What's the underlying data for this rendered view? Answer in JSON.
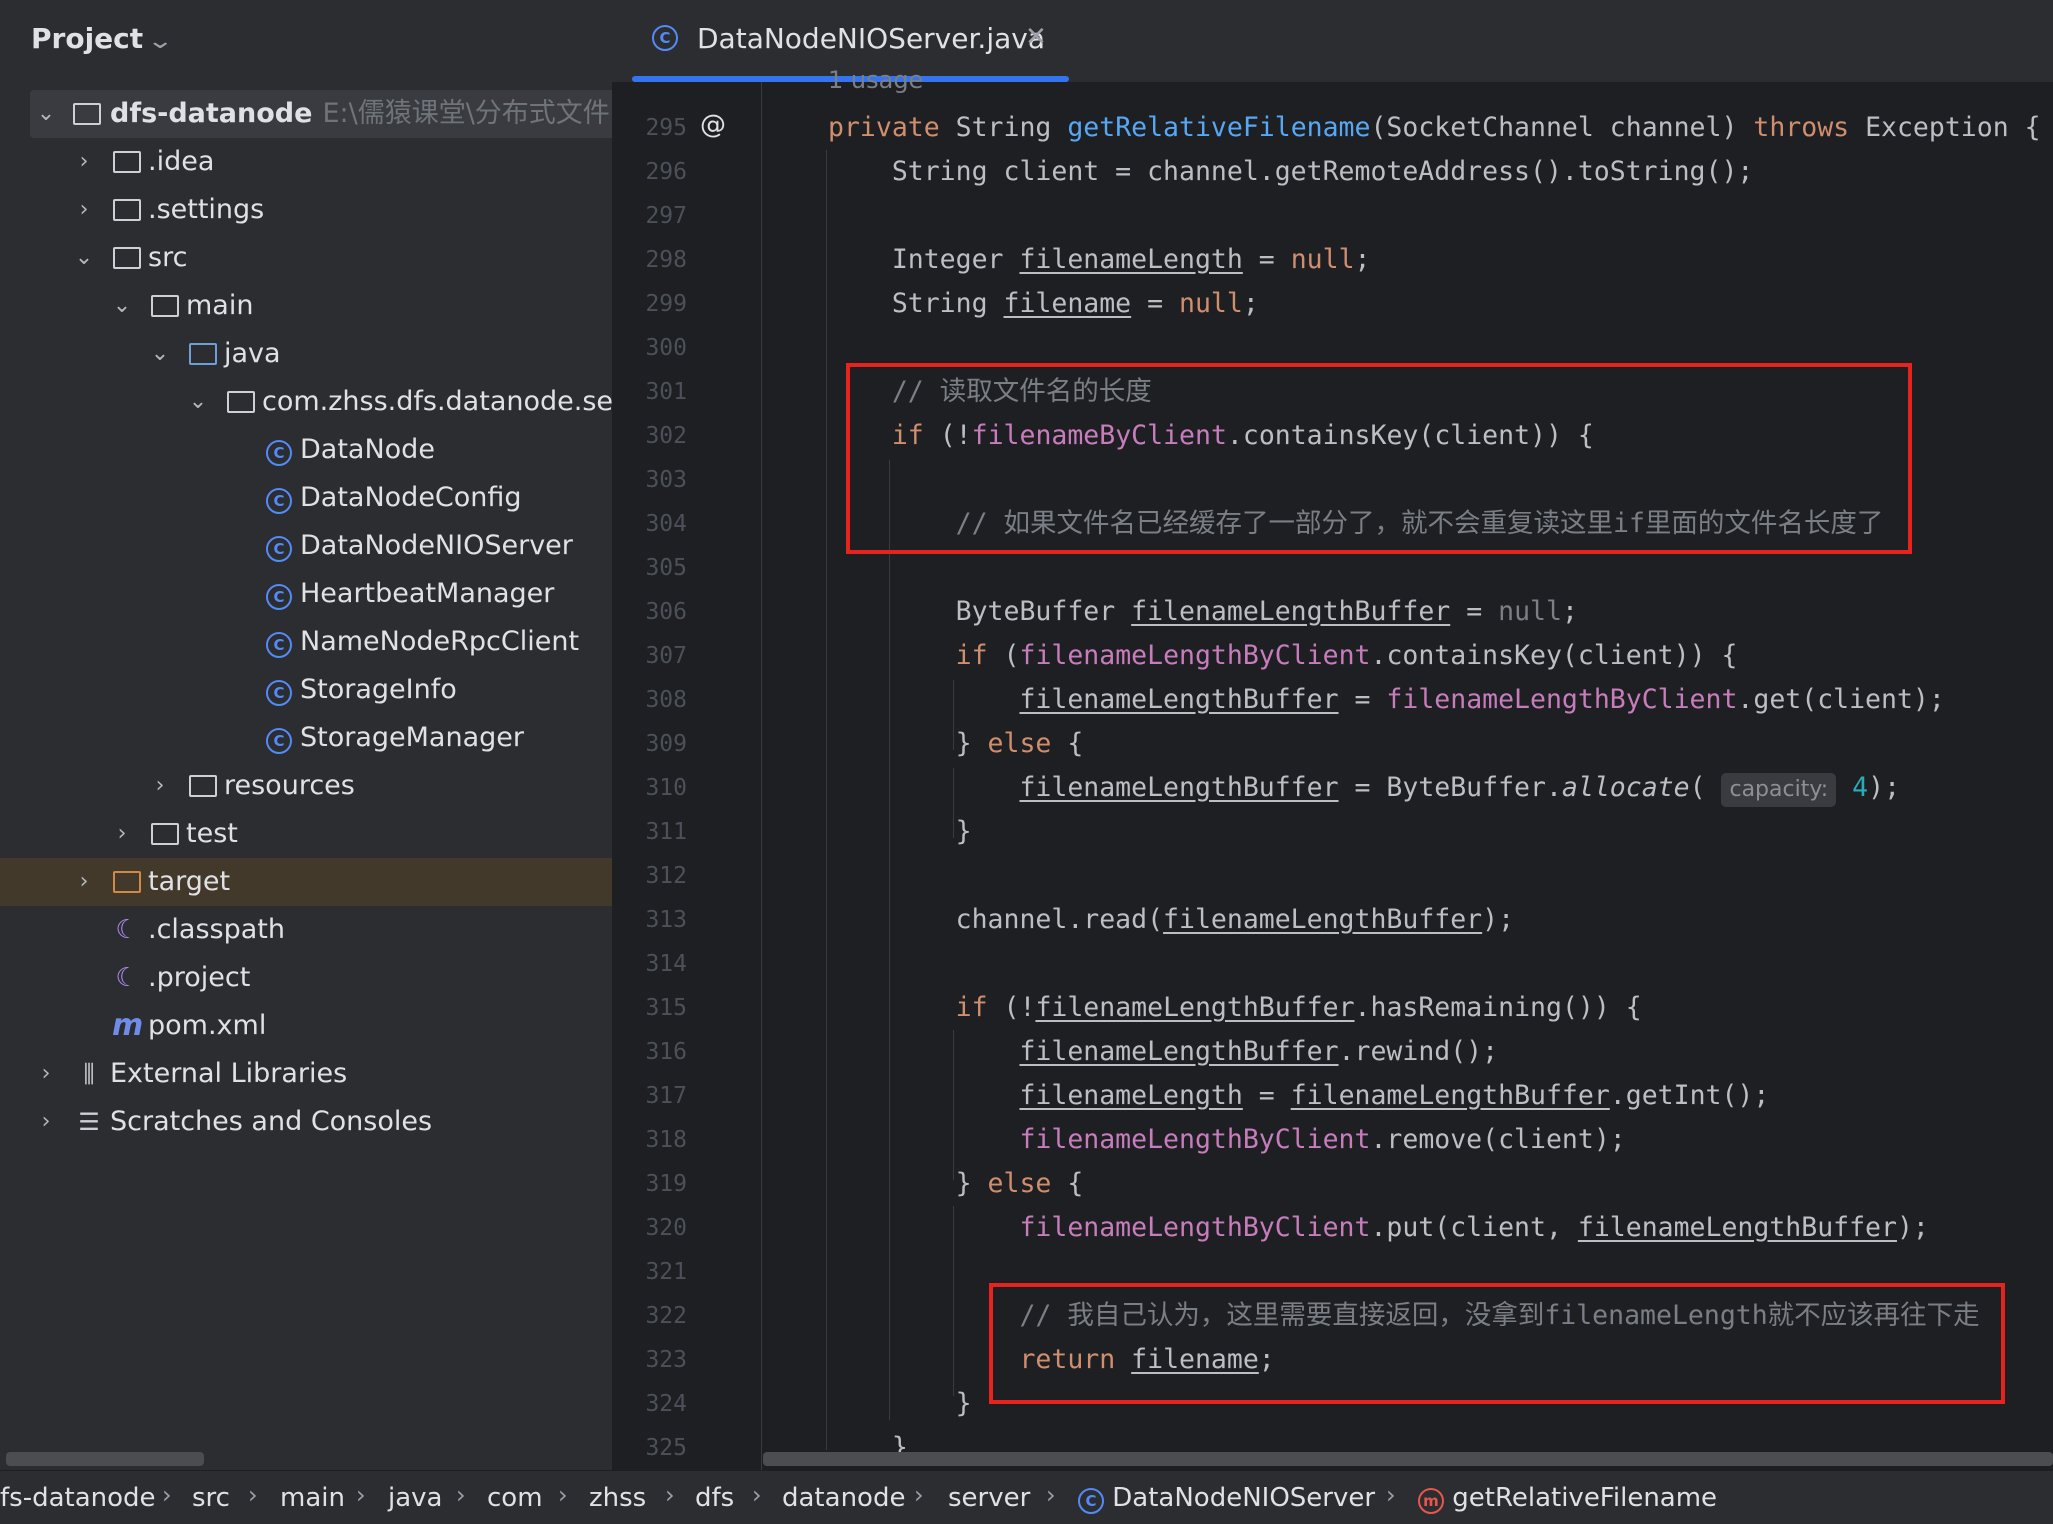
{
  "sidebar": {
    "title": "Project",
    "root": {
      "name": "dfs-datanode",
      "path_hint": "E:\\儒猿课堂\\分布式文件系统"
    },
    "items": [
      {
        "label": ".idea"
      },
      {
        "label": ".settings"
      },
      {
        "label": "src"
      },
      {
        "label": "main"
      },
      {
        "label": "java"
      },
      {
        "label": "com.zhss.dfs.datanode.server"
      },
      {
        "label": "DataNode"
      },
      {
        "label": "DataNodeConfig"
      },
      {
        "label": "DataNodeNIOServer"
      },
      {
        "label": "HeartbeatManager"
      },
      {
        "label": "NameNodeRpcClient"
      },
      {
        "label": "StorageInfo"
      },
      {
        "label": "StorageManager"
      },
      {
        "label": "resources"
      },
      {
        "label": "test"
      },
      {
        "label": "target"
      },
      {
        "label": ".classpath"
      },
      {
        "label": ".project"
      },
      {
        "label": "pom.xml"
      },
      {
        "label": "External Libraries"
      },
      {
        "label": "Scratches and Consoles"
      }
    ]
  },
  "editor": {
    "tab": {
      "label": "DataNodeNIOServer.java"
    },
    "usage_hint": "1 usage",
    "param_hint": "capacity:",
    "line_numbers": [
      "295",
      "296",
      "297",
      "298",
      "299",
      "300",
      "301",
      "302",
      "303",
      "304",
      "305",
      "306",
      "307",
      "308",
      "309",
      "310",
      "311",
      "312",
      "313",
      "314",
      "315",
      "316",
      "317",
      "318",
      "319",
      "320",
      "321",
      "322",
      "323",
      "324",
      "325"
    ],
    "comment_301": "// 读取文件名的长度",
    "comment_304": "// 如果文件名已经缓存了一部分了，就不会重复读这里if里面的文件名长度了",
    "comment_322": "// 我自己认为，这里需要直接返回，没拿到filenameLength就不应该再往下走"
  },
  "breadcrumb": [
    "fs-datanode",
    "src",
    "main",
    "java",
    "com",
    "zhss",
    "dfs",
    "datanode",
    "server",
    "DataNodeNIOServer",
    "getRelativeFilename"
  ],
  "colors": {
    "highlight_box": "#e8231d",
    "tab_accent": "#3574f0",
    "keyword": "#cf8e6d",
    "field": "#c77dbb"
  }
}
